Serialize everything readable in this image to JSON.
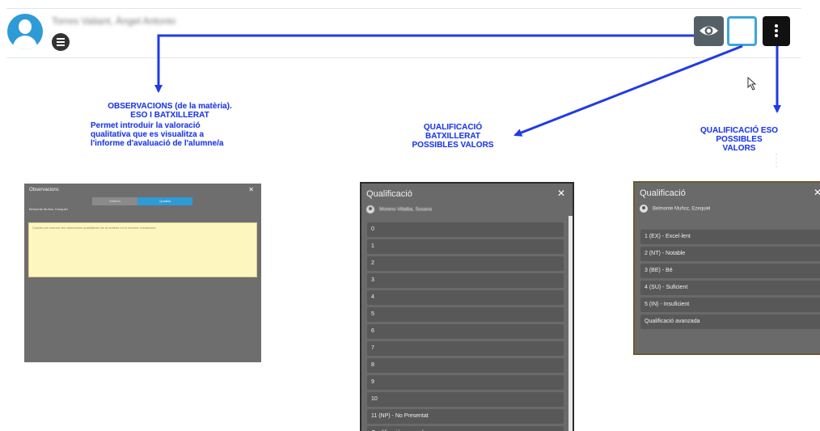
{
  "student": {
    "name": "Torres Valiant, Àngel Antonio"
  },
  "toolbar": {
    "observations_button": "eye-icon",
    "empty_button": "",
    "more_button": "more-vertical-icon"
  },
  "annotations": {
    "observacions_title_1": "OBSERVACIONS (de la matèria).",
    "observacions_title_2": "ESO I BATXILLERAT",
    "observacions_desc_1": "Permet introduir la valoració",
    "observacions_desc_2": "qualitativa que es visualitza a",
    "observacions_desc_3": "l'informe d'avaluació de l'alumne/a",
    "batxillerat_1": "QUALIFICACIÓ",
    "batxillerat_2": "BATXILLERAT",
    "batxillerat_3": "POSSIBLES VALORS",
    "eso_1": "QUALIFICACIÓ ESO",
    "eso_2": "POSSIBLES VALORS",
    "color": "#1f3be6"
  },
  "observacions_panel": {
    "title": "Observacions",
    "close": "✕",
    "tab_previous": "Matèria",
    "tab_selected": "Qualitat",
    "student": "Belmonte Muñoz, Ezequiel",
    "text": "Cuadre per escrure les valoracions qualitatives de la matèria en el informe d'avaluació"
  },
  "batxillerat_panel": {
    "title": "Qualificació",
    "close": "✕",
    "student": "Moreno Villalba, Susana",
    "options": [
      "0",
      "1",
      "2",
      "3",
      "4",
      "5",
      "6",
      "7",
      "8",
      "9",
      "10",
      "11 (NP) - No Presentat",
      "Qualificació avanzada"
    ]
  },
  "eso_panel": {
    "title": "Qualificació",
    "close": "✕",
    "student": "Belmonte Muñoz, Ezequiel",
    "options": [
      "1 (EX) - Excel·lent",
      "2 (NT) - Notable",
      "3 (BE) - Bé",
      "4 (SU) - Suficient",
      "5 (IN) - Insuficient",
      "Qualificació avanzada"
    ]
  }
}
